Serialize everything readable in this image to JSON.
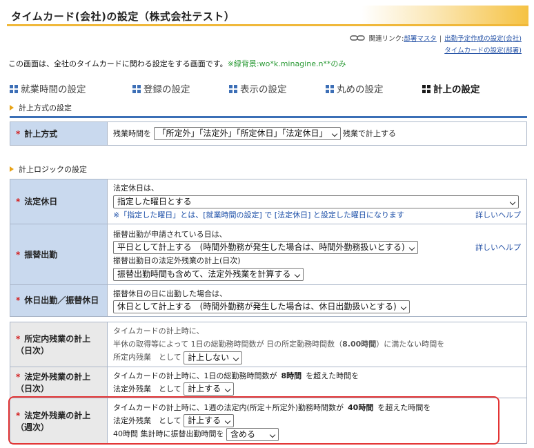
{
  "header": {
    "title": "タイムカード(会社)の設定（株式会社テスト）"
  },
  "related_links": {
    "label": "関連リンク:",
    "links": [
      "部署マスタ",
      "出勤予定作成の設定(会社)",
      "タイムカードの設定(部署)"
    ],
    "separator": "|"
  },
  "description": {
    "text": "この画面は、全社のタイムカードに関わる設定をする画面です。",
    "green_note": "※緑背景:wo*k.minagine.n**のみ"
  },
  "tabs": [
    {
      "label": "就業時間の設定"
    },
    {
      "label": "登録の設定"
    },
    {
      "label": "表示の設定"
    },
    {
      "label": "丸めの設定"
    },
    {
      "label": "計上の設定"
    }
  ],
  "sections": {
    "method": "計上方式の設定",
    "logic": "計上ロジックの設定"
  },
  "required_mark": "*",
  "method": {
    "label": "計上方式",
    "prefix": "残業時間を",
    "select": "「所定外」「法定外」「所定休日」「法定休日」",
    "suffix": "残業で計上する"
  },
  "legal_holiday": {
    "label": "法定休日",
    "line1": "法定休日は、",
    "select": "指定した曜日とする",
    "note": "※「指定した曜日」とは、[就業時間の設定] で [法定休日] と設定した曜日になります",
    "help": "詳しいヘルプ"
  },
  "substitute_work": {
    "label": "振替出勤",
    "line1": "振替出勤が申請されている日は、",
    "select1": "平日として計上する　(時間外勤務が発生した場合は、時間外勤務扱いとする)",
    "line2": "振替出勤日の法定外残業の計上(日次)",
    "select2": "振替出勤時間も含めて、法定外残業を計算する",
    "help": "詳しいヘルプ"
  },
  "holiday_work": {
    "label": "休日出勤／振替休日",
    "line1": "振替休日の日に出勤した場合は、",
    "select": "休日として計上する　(時間外勤務が発生した場合は、休日出勤扱いとする)"
  },
  "scheduled_overtime_daily": {
    "label": "所定内残業の計上（日次）",
    "line1": "タイムカードの計上時に、",
    "line2a": "半休の取得等によって 1日の総勤務時間数が 日の所定勤務時間数（",
    "line2_hours": "8.00時間",
    "line2b": "）に満たない時間を",
    "line3": "所定内残業　として",
    "select": "計上しない"
  },
  "legal_overtime_daily": {
    "label": "法定外残業の計上（日次）",
    "line1a": "タイムカードの計上時に、1日の総勤務時間数が",
    "line1_hours": "8時間",
    "line1b": "を超えた時間を",
    "line2": "法定外残業　として",
    "select": "計上する"
  },
  "legal_overtime_weekly": {
    "label": "法定外残業の計上（週次）",
    "line1a": "タイムカードの計上時に、1週の法定内(所定＋所定外)勤務時間数が",
    "line1_hours": "40時間",
    "line1b": "を超えた時間を",
    "line2": "法定外残業　として",
    "select1": "計上する",
    "line3": "40時間 集計時に振替出勤時間を",
    "select2": "含める"
  }
}
